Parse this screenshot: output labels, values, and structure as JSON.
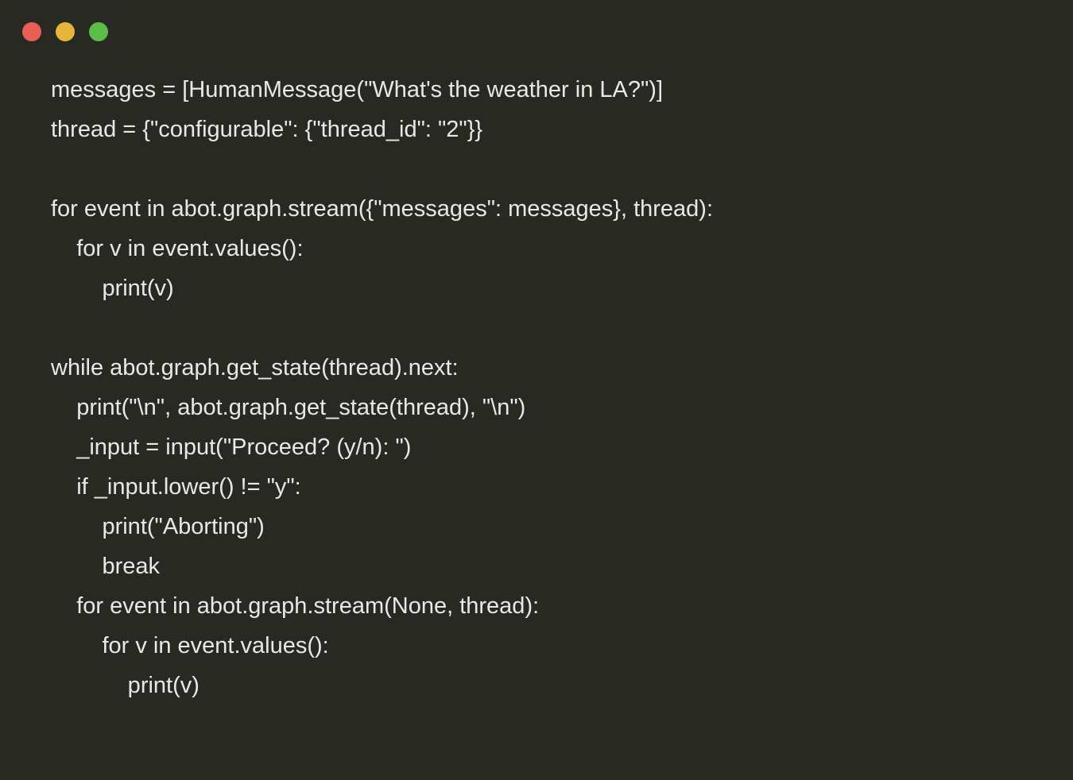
{
  "colors": {
    "background": "#282923",
    "text": "#e8e8e6",
    "red": "#ec5d54",
    "yellow": "#e5b63a",
    "green": "#5cbe49"
  },
  "code": {
    "lines": [
      "messages = [HumanMessage(\"What's the weather in LA?\")]",
      "thread = {\"configurable\": {\"thread_id\": \"2\"}}",
      "",
      "for event in abot.graph.stream({\"messages\": messages}, thread):",
      "    for v in event.values():",
      "        print(v)",
      "",
      "while abot.graph.get_state(thread).next:",
      "    print(\"\\n\", abot.graph.get_state(thread), \"\\n\")",
      "    _input = input(\"Proceed? (y/n): \")",
      "    if _input.lower() != \"y\":",
      "        print(\"Aborting\")",
      "        break",
      "    for event in abot.graph.stream(None, thread):",
      "        for v in event.values():",
      "            print(v)"
    ]
  }
}
